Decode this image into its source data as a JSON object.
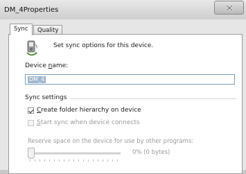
{
  "window": {
    "title": "DM_4Properties"
  },
  "tabs": [
    {
      "label": "Sync",
      "active": true
    },
    {
      "label": "Quality",
      "active": false
    }
  ],
  "sync": {
    "intro": "Set sync options for this device.",
    "device_name_label_pre": "Device ",
    "device_name_label_key": "n",
    "device_name_label_post": "ame:",
    "device_name_value": "DM_4",
    "group_title": "Sync settings",
    "options": [
      {
        "key": "C",
        "rest": "reate folder hierarchy on device",
        "checked": true,
        "enabled": true
      },
      {
        "key": "S",
        "rest": "tart sync when device connects",
        "checked": false,
        "enabled": false
      }
    ],
    "reserve_label": "Reserve space on the device for use by other programs:",
    "reserve_value": "0% (0 bytes)",
    "reserve_fraction": 0
  },
  "icons": {
    "close": "close-icon",
    "device": "portable-device-icon"
  }
}
